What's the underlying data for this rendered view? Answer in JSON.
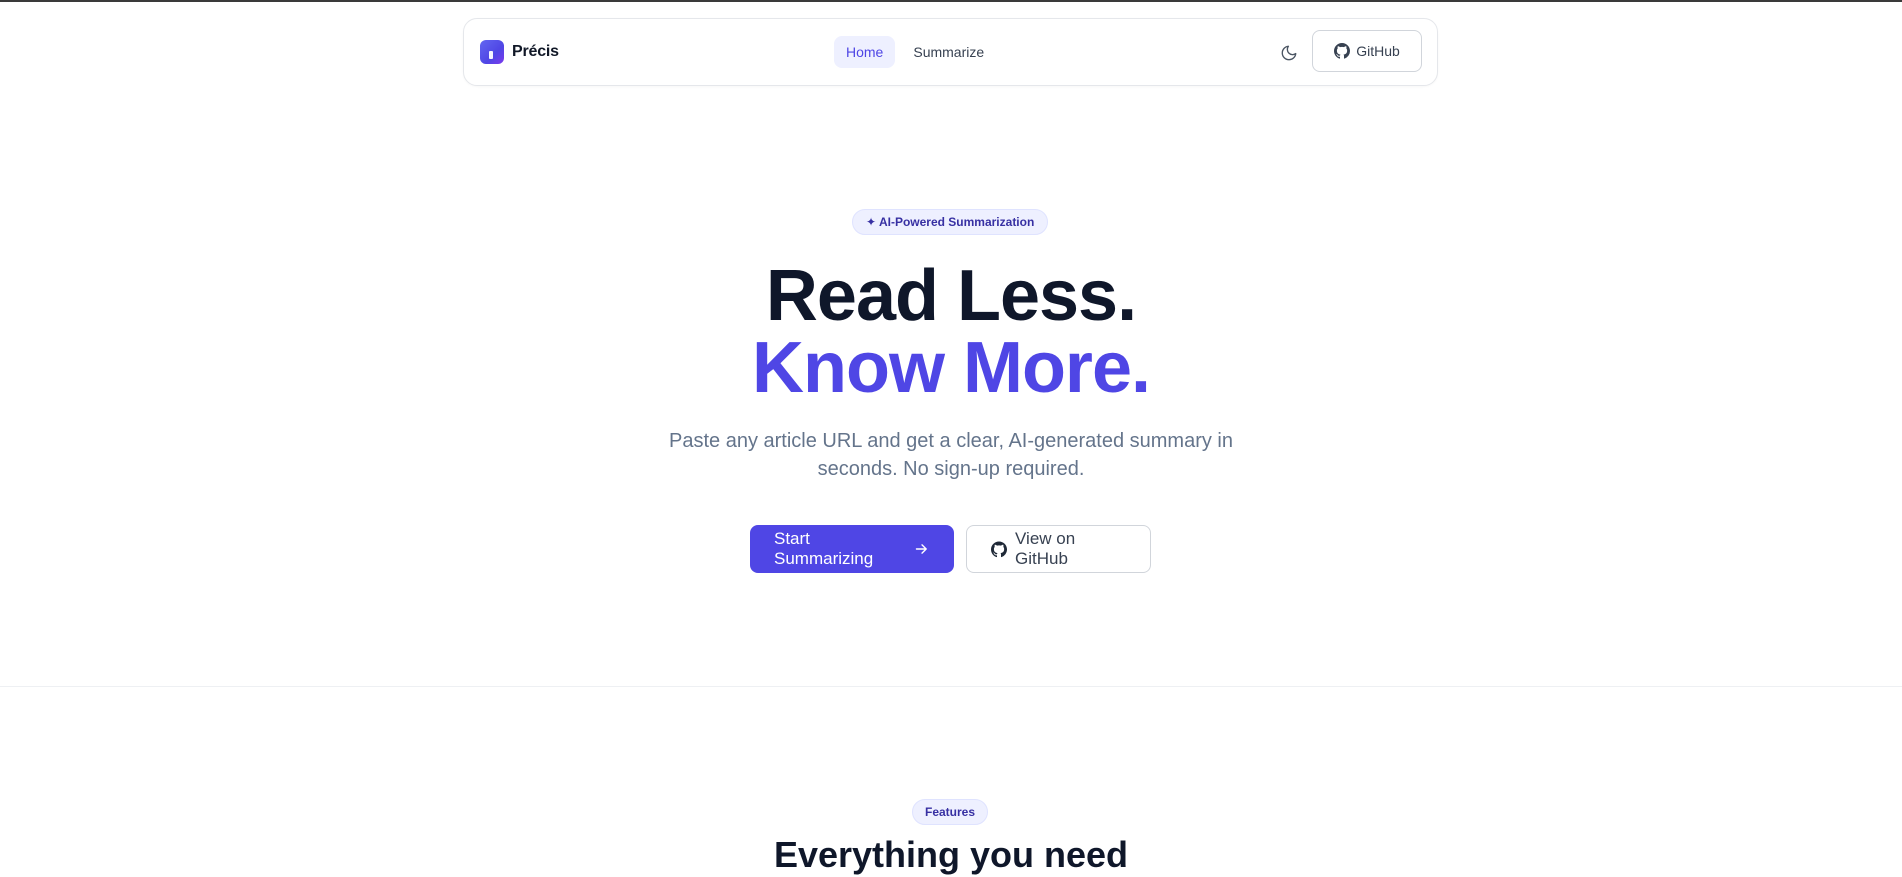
{
  "nav": {
    "brand": "Précis",
    "links": [
      {
        "label": "Home",
        "active": true
      },
      {
        "label": "Summarize",
        "active": false
      }
    ],
    "theme_toggle_icon": "moon-icon",
    "github_label": "GitHub"
  },
  "hero": {
    "badge": "✦ AI-Powered Summarization",
    "title_line1": "Read Less.",
    "title_line2": "Know More.",
    "subtitle": "Paste any article URL and get a clear, AI-generated summary in seconds. No sign-up required.",
    "primary_cta": "Start Summarizing",
    "secondary_cta": "View on GitHub"
  },
  "features": {
    "badge": "Features",
    "title": "Everything you need"
  },
  "colors": {
    "accent": "#4f46e5",
    "accent_bg": "#eef0ff",
    "heading": "#0f172a",
    "muted": "#64748b"
  }
}
